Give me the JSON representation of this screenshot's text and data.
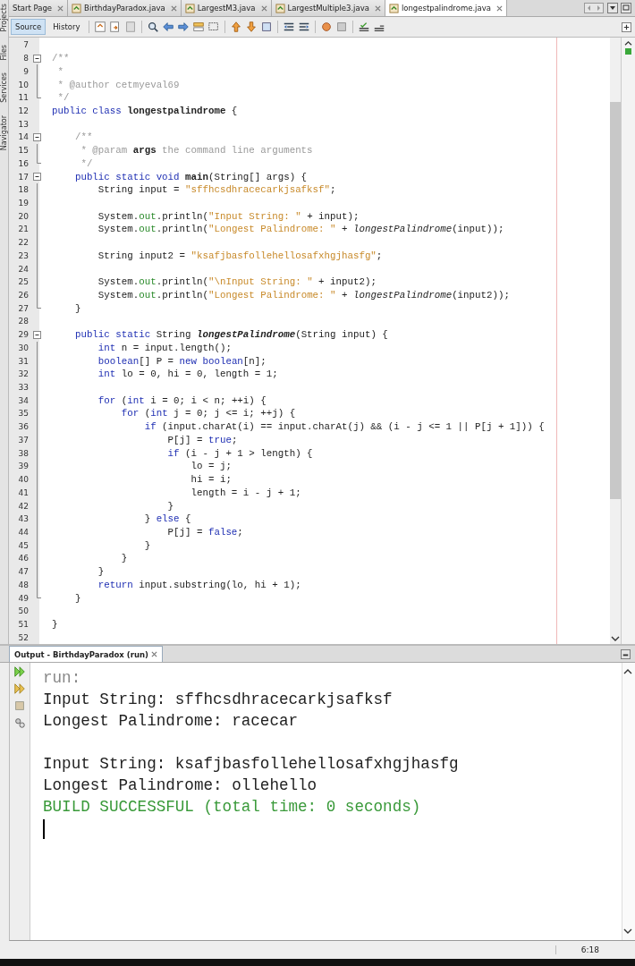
{
  "side_tabs": [
    {
      "label": "Projects"
    },
    {
      "label": "Files"
    },
    {
      "label": "Services"
    },
    {
      "label": "Navigator"
    }
  ],
  "tabs": [
    {
      "label": "Start Page",
      "selected": false,
      "file": false
    },
    {
      "label": "BirthdayParadox.java",
      "selected": false,
      "file": true
    },
    {
      "label": "LargestM3.java",
      "selected": false,
      "file": true
    },
    {
      "label": "LargestMultiple3.java",
      "selected": false,
      "file": true
    },
    {
      "label": "longestpalindrome.java",
      "selected": true,
      "file": true
    }
  ],
  "view_toggle": [
    {
      "label": "Source",
      "selected": true
    },
    {
      "label": "History",
      "selected": false
    }
  ],
  "code_lines": [
    {
      "number": "7",
      "fold_start": false,
      "fold_end": false
    },
    {
      "number": "8",
      "fold_start": true,
      "fold_end": false,
      "tokens": [
        {
          "kind": "comment",
          "text": "/**"
        }
      ]
    },
    {
      "number": "9",
      "fold_start": false,
      "fold_end": false,
      "tokens": [
        {
          "kind": "comment",
          "text": " *"
        }
      ]
    },
    {
      "number": "10",
      "fold_start": false,
      "fold_end": false,
      "tokens": [
        {
          "kind": "comment",
          "text": " * @author cetmyeval69"
        }
      ]
    },
    {
      "number": "11",
      "fold_start": false,
      "fold_end": true,
      "tokens": [
        {
          "kind": "comment",
          "text": " */"
        }
      ]
    },
    {
      "number": "12",
      "fold_start": false,
      "fold_end": false,
      "tokens": [
        {
          "kind": "keyword",
          "text": "public class "
        },
        {
          "kind": "bold",
          "text": "longestpalindrome"
        },
        {
          "kind": "plain",
          "text": " {"
        }
      ]
    },
    {
      "number": "13",
      "fold_start": false,
      "fold_end": false
    },
    {
      "number": "14",
      "fold_start": true,
      "fold_end": false,
      "tokens": [
        {
          "kind": "comment",
          "text": "    /**"
        }
      ]
    },
    {
      "number": "15",
      "fold_start": false,
      "fold_end": false,
      "tokens": [
        {
          "kind": "comment",
          "text": "     * @param "
        },
        {
          "kind": "bold",
          "text": "args"
        },
        {
          "kind": "comment",
          "text": " the command line arguments"
        }
      ]
    },
    {
      "number": "16",
      "fold_start": false,
      "fold_end": true,
      "tokens": [
        {
          "kind": "comment",
          "text": "     */"
        }
      ]
    },
    {
      "number": "17",
      "fold_start": true,
      "fold_end": false,
      "tokens": [
        {
          "kind": "keyword",
          "text": "    public static void "
        },
        {
          "kind": "bold",
          "text": "main"
        },
        {
          "kind": "plain",
          "text": "(String[] args) {"
        }
      ]
    },
    {
      "number": "18",
      "fold_start": false,
      "fold_end": false,
      "tokens": [
        {
          "kind": "plain",
          "text": "        String input = "
        },
        {
          "kind": "string",
          "text": "\"sffhcsdhracecarkjsafksf\""
        },
        {
          "kind": "plain",
          "text": ";"
        }
      ]
    },
    {
      "number": "19",
      "fold_start": false,
      "fold_end": false
    },
    {
      "number": "20",
      "fold_start": false,
      "fold_end": false,
      "tokens": [
        {
          "kind": "plain",
          "text": "        System."
        },
        {
          "kind": "field",
          "text": "out"
        },
        {
          "kind": "plain",
          "text": ".println("
        },
        {
          "kind": "string",
          "text": "\"Input String: \""
        },
        {
          "kind": "plain",
          "text": " + input);"
        }
      ]
    },
    {
      "number": "21",
      "fold_start": false,
      "fold_end": false,
      "tokens": [
        {
          "kind": "plain",
          "text": "        System."
        },
        {
          "kind": "field",
          "text": "out"
        },
        {
          "kind": "plain",
          "text": ".println("
        },
        {
          "kind": "string",
          "text": "\"Longest Palindrome: \""
        },
        {
          "kind": "plain",
          "text": " + "
        },
        {
          "kind": "italic",
          "text": "longestPalindrome"
        },
        {
          "kind": "plain",
          "text": "(input));"
        }
      ]
    },
    {
      "number": "22",
      "fold_start": false,
      "fold_end": false
    },
    {
      "number": "23",
      "fold_start": false,
      "fold_end": false,
      "tokens": [
        {
          "kind": "plain",
          "text": "        String input2 = "
        },
        {
          "kind": "string",
          "text": "\"ksafjbasfollehellosafxhgjhasfg\""
        },
        {
          "kind": "plain",
          "text": ";"
        }
      ]
    },
    {
      "number": "24",
      "fold_start": false,
      "fold_end": false
    },
    {
      "number": "25",
      "fold_start": false,
      "fold_end": false,
      "tokens": [
        {
          "kind": "plain",
          "text": "        System."
        },
        {
          "kind": "field",
          "text": "out"
        },
        {
          "kind": "plain",
          "text": ".println("
        },
        {
          "kind": "string",
          "text": "\"\\nInput String: \""
        },
        {
          "kind": "plain",
          "text": " + input2);"
        }
      ]
    },
    {
      "number": "26",
      "fold_start": false,
      "fold_end": false,
      "tokens": [
        {
          "kind": "plain",
          "text": "        System."
        },
        {
          "kind": "field",
          "text": "out"
        },
        {
          "kind": "plain",
          "text": ".println("
        },
        {
          "kind": "string",
          "text": "\"Longest Palindrome: \""
        },
        {
          "kind": "plain",
          "text": " + "
        },
        {
          "kind": "italic",
          "text": "longestPalindrome"
        },
        {
          "kind": "plain",
          "text": "(input2));"
        }
      ]
    },
    {
      "number": "27",
      "fold_start": false,
      "fold_end": true,
      "tokens": [
        {
          "kind": "plain",
          "text": "    }"
        }
      ]
    },
    {
      "number": "28",
      "fold_start": false,
      "fold_end": false
    },
    {
      "number": "29",
      "fold_start": true,
      "fold_end": false,
      "tokens": [
        {
          "kind": "keyword",
          "text": "    public static "
        },
        {
          "kind": "plain",
          "text": "String "
        },
        {
          "kind": "bolditalic",
          "text": "longestPalindrome"
        },
        {
          "kind": "plain",
          "text": "(String input) {"
        }
      ]
    },
    {
      "number": "30",
      "fold_start": false,
      "fold_end": false,
      "tokens": [
        {
          "kind": "keyword",
          "text": "        int"
        },
        {
          "kind": "plain",
          "text": " n = input.length();"
        }
      ]
    },
    {
      "number": "31",
      "fold_start": false,
      "fold_end": false,
      "tokens": [
        {
          "kind": "keyword",
          "text": "        boolean"
        },
        {
          "kind": "plain",
          "text": "[] P = "
        },
        {
          "kind": "keyword",
          "text": "new boolean"
        },
        {
          "kind": "plain",
          "text": "[n];"
        }
      ]
    },
    {
      "number": "32",
      "fold_start": false,
      "fold_end": false,
      "tokens": [
        {
          "kind": "keyword",
          "text": "        int"
        },
        {
          "kind": "plain",
          "text": " lo = 0, hi = 0, length = 1;"
        }
      ]
    },
    {
      "number": "33",
      "fold_start": false,
      "fold_end": false
    },
    {
      "number": "34",
      "fold_start": false,
      "fold_end": false,
      "tokens": [
        {
          "kind": "keyword",
          "text": "        for"
        },
        {
          "kind": "plain",
          "text": " ("
        },
        {
          "kind": "keyword",
          "text": "int"
        },
        {
          "kind": "plain",
          "text": " i = 0; i < n; ++i) {"
        }
      ]
    },
    {
      "number": "35",
      "fold_start": false,
      "fold_end": false,
      "tokens": [
        {
          "kind": "keyword",
          "text": "            for"
        },
        {
          "kind": "plain",
          "text": " ("
        },
        {
          "kind": "keyword",
          "text": "int"
        },
        {
          "kind": "plain",
          "text": " j = 0; j <= i; ++j) {"
        }
      ]
    },
    {
      "number": "36",
      "fold_start": false,
      "fold_end": false,
      "tokens": [
        {
          "kind": "keyword",
          "text": "                if"
        },
        {
          "kind": "plain",
          "text": " (input.charAt(i) == input.charAt(j) && (i - j <= 1 || P[j + 1])) {"
        }
      ]
    },
    {
      "number": "37",
      "fold_start": false,
      "fold_end": false,
      "tokens": [
        {
          "kind": "plain",
          "text": "                    P[j] = "
        },
        {
          "kind": "keyword",
          "text": "true"
        },
        {
          "kind": "plain",
          "text": ";"
        }
      ]
    },
    {
      "number": "38",
      "fold_start": false,
      "fold_end": false,
      "tokens": [
        {
          "kind": "keyword",
          "text": "                    if"
        },
        {
          "kind": "plain",
          "text": " (i - j + 1 > length) {"
        }
      ]
    },
    {
      "number": "39",
      "fold_start": false,
      "fold_end": false,
      "tokens": [
        {
          "kind": "plain",
          "text": "                        lo = j;"
        }
      ]
    },
    {
      "number": "40",
      "fold_start": false,
      "fold_end": false,
      "tokens": [
        {
          "kind": "plain",
          "text": "                        hi = i;"
        }
      ]
    },
    {
      "number": "41",
      "fold_start": false,
      "fold_end": false,
      "tokens": [
        {
          "kind": "plain",
          "text": "                        length = i - j + 1;"
        }
      ]
    },
    {
      "number": "42",
      "fold_start": false,
      "fold_end": false,
      "tokens": [
        {
          "kind": "plain",
          "text": "                    }"
        }
      ]
    },
    {
      "number": "43",
      "fold_start": false,
      "fold_end": false,
      "tokens": [
        {
          "kind": "plain",
          "text": "                } "
        },
        {
          "kind": "keyword",
          "text": "else"
        },
        {
          "kind": "plain",
          "text": " {"
        }
      ]
    },
    {
      "number": "44",
      "fold_start": false,
      "fold_end": false,
      "tokens": [
        {
          "kind": "plain",
          "text": "                    P[j] = "
        },
        {
          "kind": "keyword",
          "text": "false"
        },
        {
          "kind": "plain",
          "text": ";"
        }
      ]
    },
    {
      "number": "45",
      "fold_start": false,
      "fold_end": false,
      "tokens": [
        {
          "kind": "plain",
          "text": "                }"
        }
      ]
    },
    {
      "number": "46",
      "fold_start": false,
      "fold_end": false,
      "tokens": [
        {
          "kind": "plain",
          "text": "            }"
        }
      ]
    },
    {
      "number": "47",
      "fold_start": false,
      "fold_end": false,
      "tokens": [
        {
          "kind": "plain",
          "text": "        }"
        }
      ]
    },
    {
      "number": "48",
      "fold_start": false,
      "fold_end": false,
      "tokens": [
        {
          "kind": "keyword",
          "text": "        return"
        },
        {
          "kind": "plain",
          "text": " input.substring(lo, hi + 1);"
        }
      ]
    },
    {
      "number": "49",
      "fold_start": false,
      "fold_end": true,
      "tokens": [
        {
          "kind": "plain",
          "text": "    }"
        }
      ]
    },
    {
      "number": "50",
      "fold_start": false,
      "fold_end": false
    },
    {
      "number": "51",
      "fold_start": false,
      "fold_end": false,
      "tokens": [
        {
          "kind": "plain",
          "text": "}"
        }
      ]
    },
    {
      "number": "52",
      "fold_start": false,
      "fold_end": false
    }
  ],
  "output": {
    "title": "Output - BirthdayParadox (run)",
    "lines": [
      {
        "kind": "info",
        "text": "run:"
      },
      {
        "kind": "normal",
        "text": "Input String: sffhcsdhracecarkjsafksf"
      },
      {
        "kind": "normal",
        "text": "Longest Palindrome: racecar"
      },
      {
        "kind": "blank"
      },
      {
        "kind": "normal",
        "text": "Input String: ksafjbasfollehellosafxhgjhasfg"
      },
      {
        "kind": "normal",
        "text": "Longest Palindrome: ollehello"
      },
      {
        "kind": "success",
        "text": "BUILD SUCCESSFUL (total time: 0 seconds)"
      }
    ]
  },
  "status_bar": {
    "position": "6:18"
  }
}
